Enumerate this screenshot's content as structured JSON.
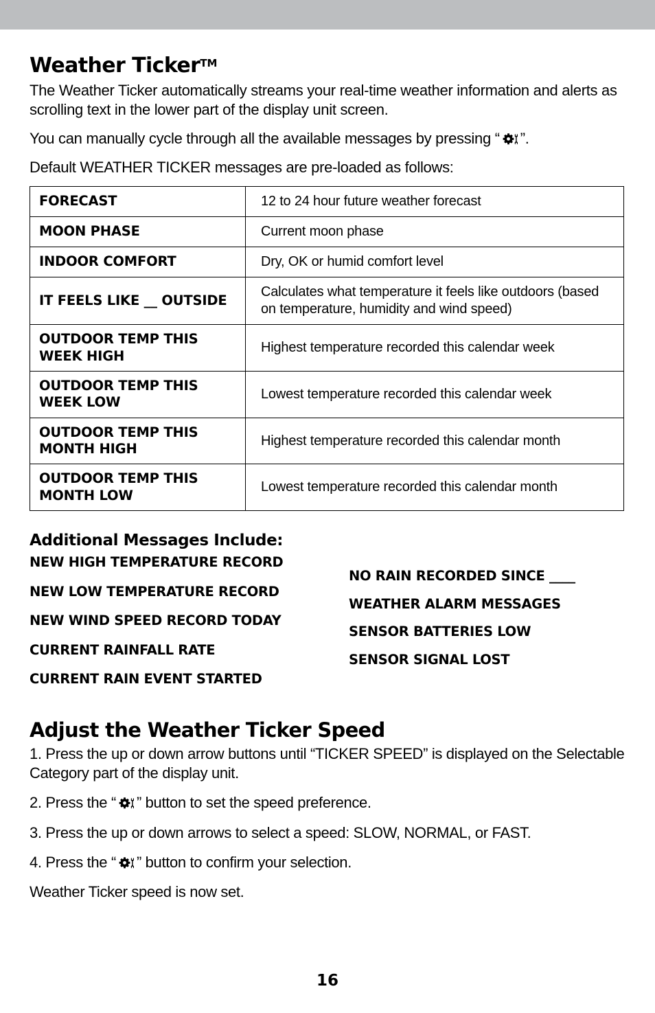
{
  "page": {
    "number": "16",
    "band_color": "#bcbec0",
    "text_color": "#000000"
  },
  "section1": {
    "title": "Weather Ticker",
    "title_tm": "TM",
    "para1": "The Weather Ticker automatically streams your real-time weather information and alerts as scrolling text in the lower part of the display unit screen.",
    "para2_before": "You can manually cycle through all the available messages by pressing “",
    "para2_after": "”.",
    "para3": "Default WEATHER TICKER messages are pre-loaded as follows:",
    "icon_name": "gear-wrench-icon"
  },
  "ticker_table": {
    "rows": [
      {
        "message": "FORECAST",
        "description": "12 to 24 hour future weather forecast"
      },
      {
        "message": "MOON PHASE",
        "description": "Current moon phase"
      },
      {
        "message": "INDOOR COMFORT",
        "description": "Dry, OK or humid comfort level"
      },
      {
        "message": "IT FEELS LIKE __ OUTSIDE",
        "description": "Calculates what temperature it feels like outdoors (based on temperature, humidity and wind speed)"
      },
      {
        "message": "OUTDOOR TEMP THIS WEEK HIGH",
        "description": "Highest temperature recorded this calendar week"
      },
      {
        "message": "OUTDOOR TEMP THIS WEEK LOW",
        "description": "Lowest temperature recorded this calendar week"
      },
      {
        "message": "OUTDOOR TEMP THIS MONTH HIGH",
        "description": "Highest temperature recorded this calendar month"
      },
      {
        "message": "OUTDOOR TEMP THIS MONTH LOW",
        "description": "Lowest temperature recorded this calendar month"
      }
    ]
  },
  "additional": {
    "title": "Additional Messages Include:",
    "left_column": [
      "NEW HIGH TEMPERATURE RECORD",
      "NEW LOW TEMPERATURE RECORD",
      "NEW WIND SPEED RECORD TODAY",
      "CURRENT RAINFALL RATE",
      "CURRENT RAIN EVENT STARTED"
    ],
    "right_column": [
      "NO RAIN RECORDED SINCE ____",
      "WEATHER ALARM MESSAGES",
      "SENSOR BATTERIES LOW",
      "SENSOR SIGNAL LOST"
    ]
  },
  "section2": {
    "title": "Adjust the Weather Ticker Speed",
    "step1": "1. Press the up or down arrow buttons until “TICKER SPEED” is displayed on the Selectable Category part of the display unit.",
    "step2_before": "2. Press the “",
    "step2_after": "” button to set the speed preference.",
    "step3": "3. Press the up or down arrows to select a speed: SLOW, NORMAL, or FAST.",
    "step4_before": "4. Press the “",
    "step4_after": "” button to confirm your selection.",
    "closing": "Weather Ticker speed is now set."
  }
}
